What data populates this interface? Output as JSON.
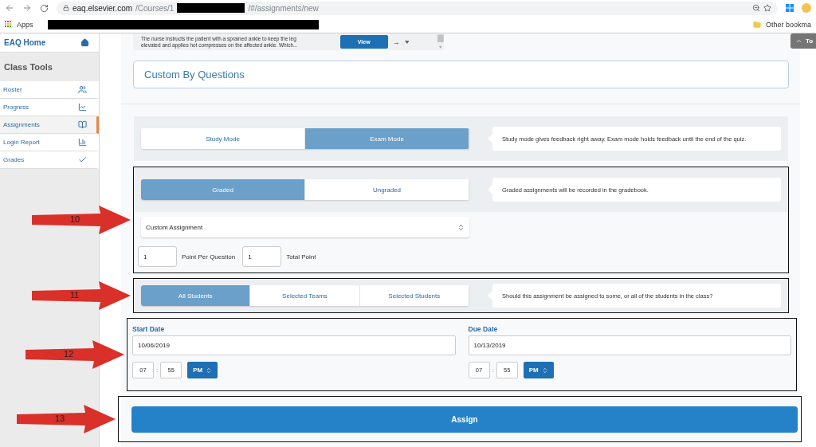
{
  "browser": {
    "url_host": "eaq.elsevier.com",
    "url_path_start": "/Courses/1",
    "url_path_end": "/#/assignments/new",
    "apps_label": "Apps",
    "other_bookmarks": "Other bookma"
  },
  "sidebar": {
    "home": "EAQ Home",
    "section": "Class Tools",
    "items": [
      {
        "label": "Roster",
        "selected": false
      },
      {
        "label": "Progress",
        "selected": false
      },
      {
        "label": "Assignments",
        "selected": true
      },
      {
        "label": "Login Report",
        "selected": false
      },
      {
        "label": "Grades",
        "selected": false
      }
    ]
  },
  "question_preview": {
    "lines": [
      "The nurse instructs the patient with a sprained ankle to keep the leg",
      "elevated and applies hot compresses on the affected ankle. Which..."
    ],
    "view_button": "View",
    "arrow": "→"
  },
  "top_tab": "To",
  "panel_title": "Custom By Questions",
  "mode": {
    "options": [
      {
        "label": "Study Mode",
        "selected": false
      },
      {
        "label": "Exam Mode",
        "selected": true
      }
    ],
    "info": "Study mode gives feedback right away. Exam mode holds feedback until the end of the quiz."
  },
  "grading": {
    "annotation": "10",
    "options": [
      {
        "label": "Graded",
        "selected": true
      },
      {
        "label": "Ungraded",
        "selected": false
      }
    ],
    "info": "Graded assignments will be recorded in the gradebook.",
    "assignment_type": "Custom Assignment",
    "points_row": [
      {
        "kind": "field",
        "text": "1"
      },
      {
        "kind": "caption",
        "text": "Point Per Question"
      },
      {
        "kind": "field",
        "text": "1"
      },
      {
        "kind": "caption",
        "text": "Total Point"
      }
    ]
  },
  "audience": {
    "annotation": "11",
    "options": [
      {
        "label": "All Students",
        "selected": true
      },
      {
        "label": "Selected Teams",
        "selected": false
      },
      {
        "label": "Selected Students",
        "selected": false
      }
    ],
    "info": "Should this assignment be assigned to some, or all of the students in the class?"
  },
  "dates": {
    "annotation": "12",
    "fields": [
      {
        "label": "Start Date",
        "date": "10/06/2019",
        "hour": "07",
        "separator": ":",
        "minute": "55",
        "meridiem": "PM"
      },
      {
        "label": "Due Date",
        "date": "10/13/2019",
        "hour": "07",
        "separator": ":",
        "minute": "55",
        "meridiem": "PM"
      }
    ]
  },
  "submit": {
    "annotation": "13",
    "label": "Assign"
  }
}
